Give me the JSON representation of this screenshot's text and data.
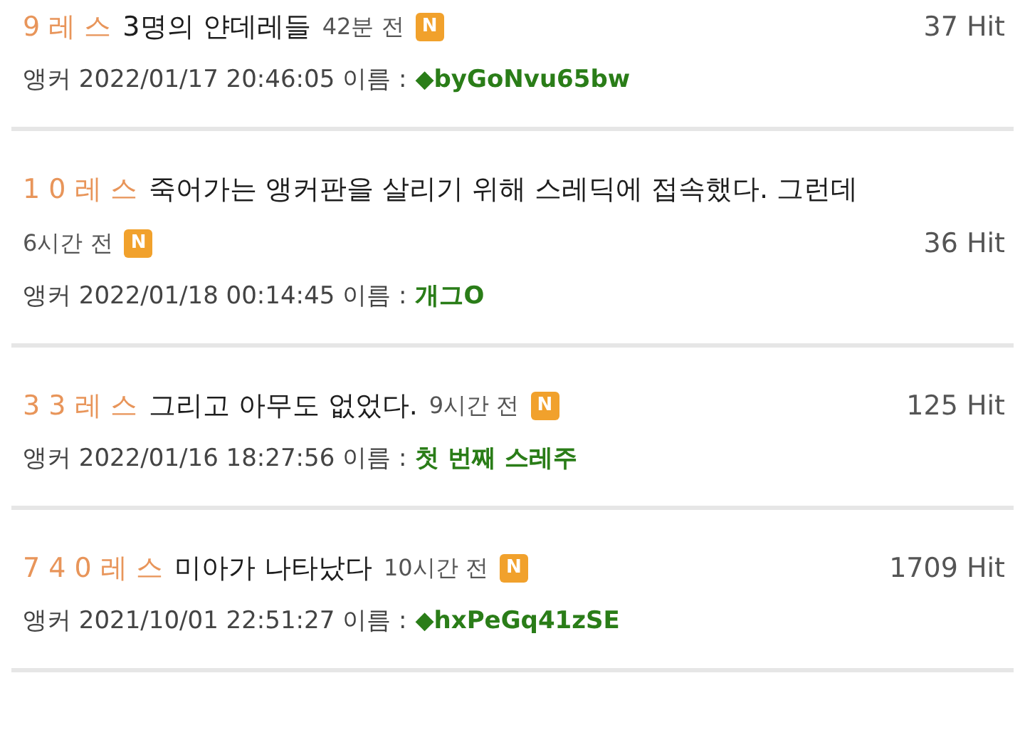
{
  "threads": [
    {
      "res": "9 레 스",
      "title": "3명의 얀데레들",
      "time": "42분 전",
      "new_badge": "N",
      "hits": "37 Hit",
      "anchor": "앵커 2022/01/17 20:46:05 이름 :",
      "author": "◆byGoNvu65bw"
    },
    {
      "res": "1 0 레 스",
      "title": "죽어가는 앵커판을 살리기 위해 스레딕에 접속했다. 그런데",
      "time": "6시간 전",
      "new_badge": "N",
      "hits": "36 Hit",
      "anchor": "앵커 2022/01/18 00:14:45 이름 :",
      "author": "개그O"
    },
    {
      "res": "3 3 레 스",
      "title": "그리고 아무도 없었다.",
      "time": "9시간 전",
      "new_badge": "N",
      "hits": "125 Hit",
      "anchor": "앵커 2022/01/16 18:27:56 이름 :",
      "author": "첫 번째 스레주"
    },
    {
      "res": "7 4 0 레 스",
      "title": "미아가 나타났다",
      "time": "10시간 전",
      "new_badge": "N",
      "hits": "1709 Hit",
      "anchor": "앵커 2021/10/01 22:51:27 이름 :",
      "author": "◆hxPeGq41zSE"
    }
  ]
}
